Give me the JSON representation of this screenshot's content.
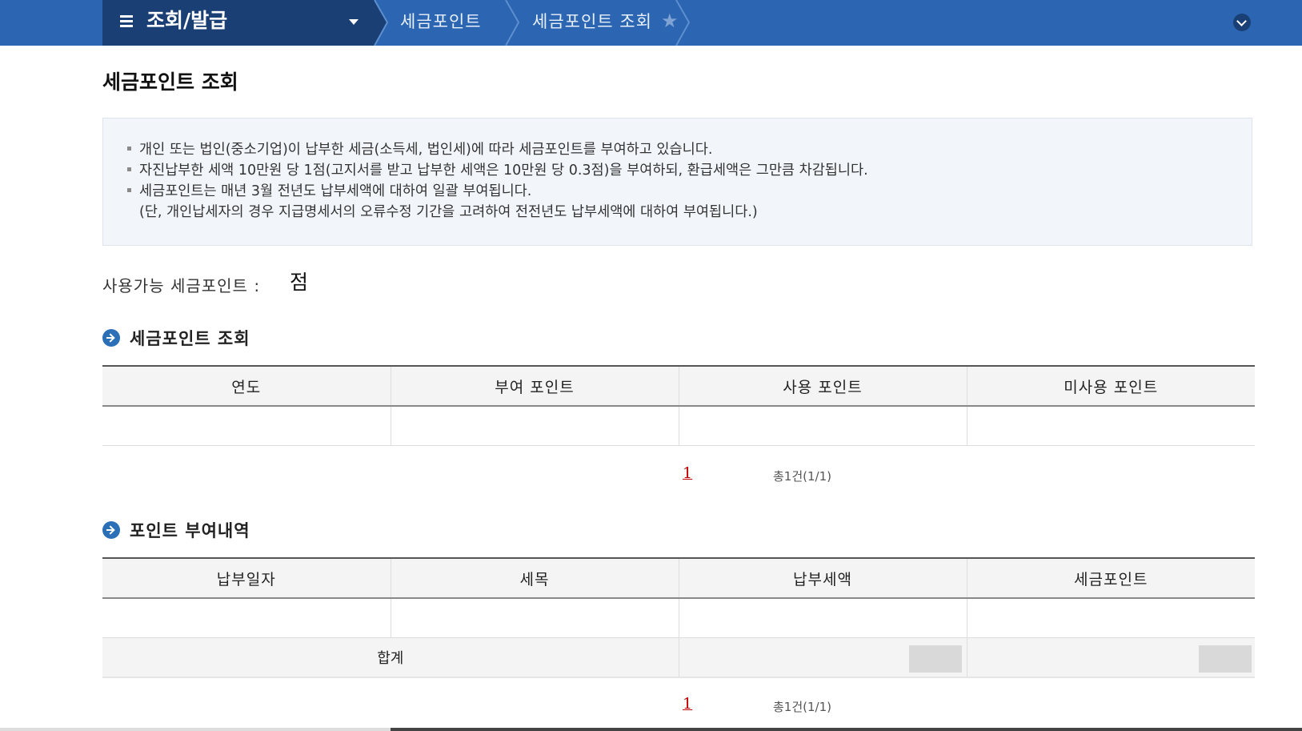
{
  "topbar": {
    "menu_title": "조회/발급",
    "crumbs": [
      "세금포인트",
      "세금포인트 조회"
    ]
  },
  "page_title": "세금포인트 조회",
  "notice": [
    "개인 또는 법인(중소기업)이 납부한 세금(소득세, 법인세)에 따라 세금포인트를 부여하고 있습니다.",
    "자진납부한 세액 10만원 당 1점(고지서를 받고 납부한 세액은 10만원 당 0.3점)을 부여하되, 환급세액은 그만큼 차감됩니다.",
    "세금포인트는 매년 3월 전년도 납부세액에 대하여 일괄 부여됩니다.",
    "(단, 개인납세자의 경우 지급명세서의 오류수정 기간을 고려하여 전전년도 납부세액에 대하여 부여됩니다.)"
  ],
  "available": {
    "label": "사용가능 세금포인트 :",
    "unit": "점"
  },
  "section1": {
    "title": "세금포인트 조회",
    "headers": [
      "연도",
      "부여 포인트",
      "사용 포인트",
      "미사용 포인트"
    ],
    "page": "1",
    "count": "총1건(1/1)"
  },
  "section2": {
    "title": "포인트 부여내역",
    "headers": [
      "납부일자",
      "세목",
      "납부세액",
      "세금포인트"
    ],
    "sum_label": "합계",
    "page": "1",
    "count": "총1건(1/1)"
  }
}
